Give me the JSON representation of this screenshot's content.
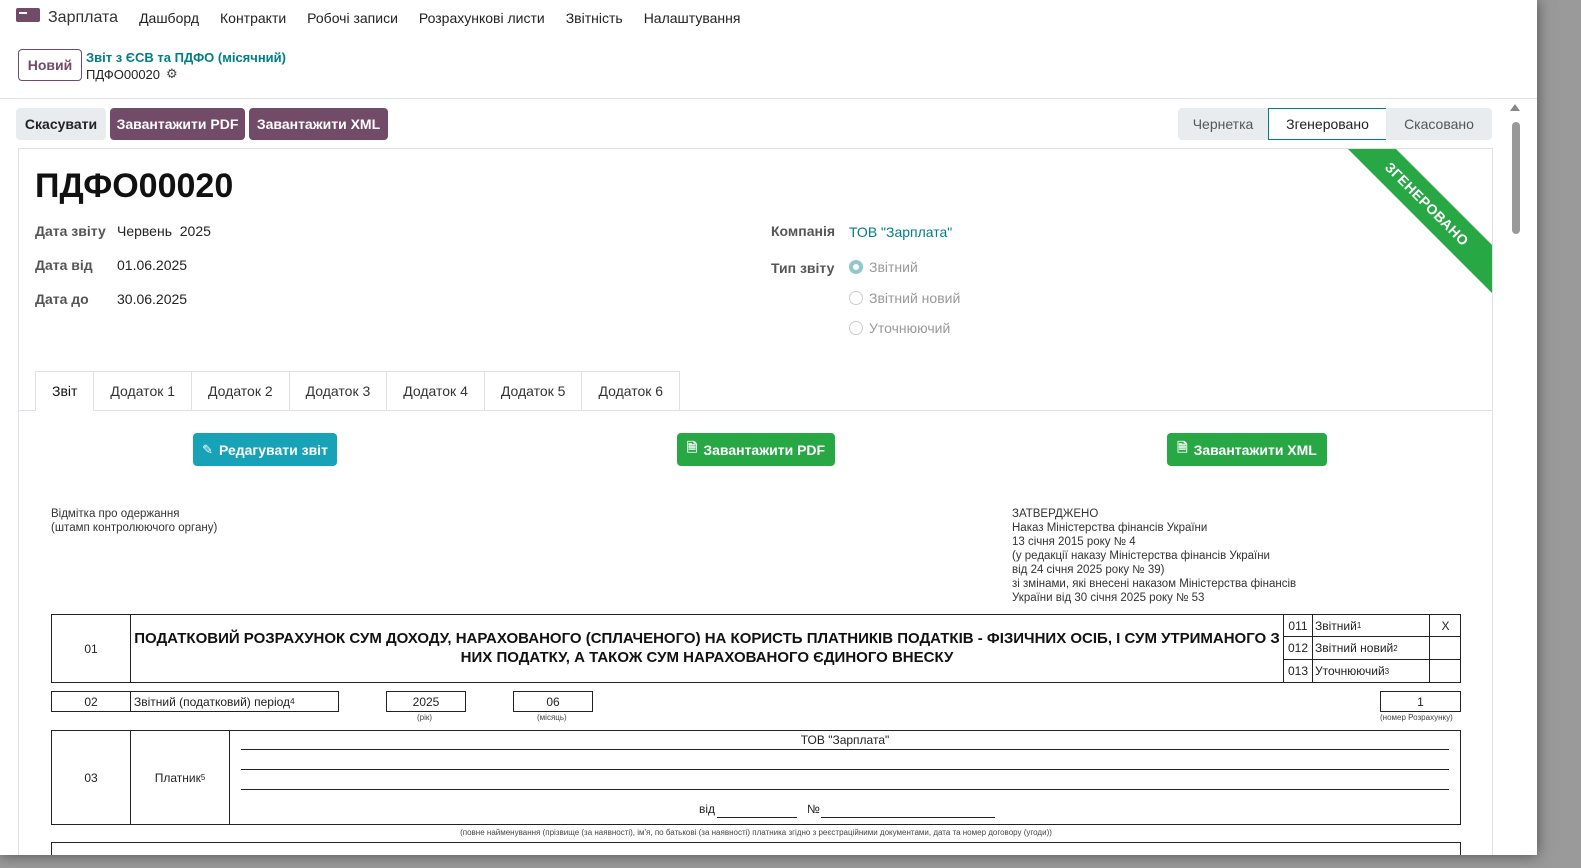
{
  "nav": {
    "app_title": "Зарплата",
    "items": [
      "Дашборд",
      "Контракти",
      "Робочі записи",
      "Розрахункові листи",
      "Звітність",
      "Налаштування"
    ]
  },
  "control": {
    "new_label": "Новий",
    "breadcrumb_parent": "Звіт з ЄСВ та ПДФО (місячний)",
    "breadcrumb_current": "ПДФО00020"
  },
  "actions": {
    "cancel": "Скасувати",
    "download_pdf": "Завантажити PDF",
    "download_xml": "Завантажити XML"
  },
  "status": {
    "steps": [
      "Чернетка",
      "Згенеровано",
      "Скасовано"
    ],
    "active": "Згенеровано",
    "ribbon": "ЗГЕНЕРОВАНО"
  },
  "record": {
    "title": "ПДФО00020",
    "report_date_label": "Дата звіту",
    "report_date": "Червень  2025",
    "date_from_label": "Дата від",
    "date_from": "01.06.2025",
    "date_to_label": "Дата до",
    "date_to": "30.06.2025",
    "company_label": "Компанія",
    "company": "ТОВ \"Зарплата\"",
    "type_label": "Тип звіту",
    "type_options": [
      "Звітний",
      "Звітний новий",
      "Уточнюючий"
    ],
    "type_selected": "Звітний"
  },
  "tabs": [
    "Звіт",
    "Додаток 1",
    "Додаток 2",
    "Додаток 3",
    "Додаток 4",
    "Додаток 5",
    "Додаток 6"
  ],
  "tab_buttons": {
    "edit": "Редагувати звіт",
    "pdf": "Завантажити PDF",
    "xml": "Завантажити XML"
  },
  "document": {
    "stamp_line1": "Відмітка про одержання",
    "stamp_line2": "(штамп контролюючого органу)",
    "approved": [
      "ЗАТВЕРДЖЕНО",
      "Наказ Міністерства фінансів України",
      "13 січня 2015 року № 4",
      "(у редакції наказу Міністерства фінансів України",
      "від 24 січня 2025 року № 39)",
      "зі змінами, які внесені наказом Міністерства фінансів",
      "України від 30 січня 2025 року № 53"
    ],
    "code01": "01",
    "title": "ПОДАТКОВИЙ РОЗРАХУНОК СУМ ДОХОДУ, НАРАХОВАНОГО (СПЛАЧЕНОГО) НА КОРИСТЬ ПЛАТНИКІВ ПОДАТКІВ - ФІЗИЧНИХ ОСІБ, І СУМ УТРИМАНОГО З НИХ ПОДАТКУ, А ТАКОЖ СУМ НАРАХОВАНОГО ЄДИНОГО ВНЕСКУ",
    "kinds": [
      {
        "code": "011",
        "label": "Звітний",
        "sup": "1",
        "mark": "Х"
      },
      {
        "code": "012",
        "label": "Звітний новий",
        "sup": "2",
        "mark": ""
      },
      {
        "code": "013",
        "label": "Уточнюючий",
        "sup": "3",
        "mark": ""
      }
    ],
    "code02": "02",
    "period_label": "Звітний (податковий) період",
    "period_sup": "4",
    "year": "2025",
    "year_caption": "(рік)",
    "month": "06",
    "month_caption": "(місяць)",
    "calc_number": "1",
    "calc_caption": "(номер Розрахунку)",
    "code03": "03",
    "payer_label": "Платник",
    "payer_sup": "5",
    "payer_name": "ТОВ \"Зарплата\"",
    "from_label": "від",
    "num_label": "№",
    "payer_caption": "(повне найменування (прізвище (за наявності), ім'я, по батькові (за наявності) платника згідно з реєстраційними документами, дата та номер договору (угоди))"
  }
}
